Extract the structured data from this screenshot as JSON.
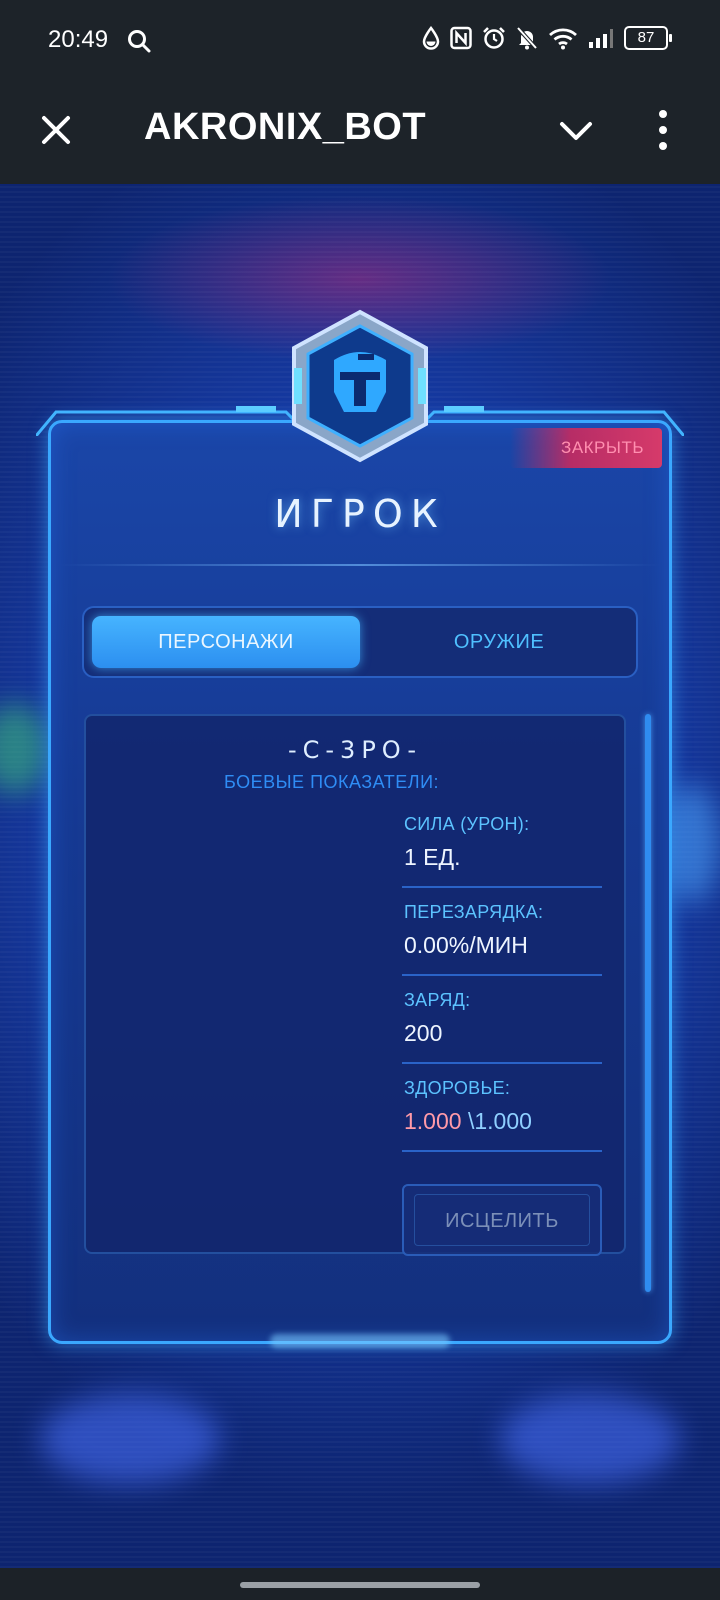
{
  "status_bar": {
    "time": "20:49",
    "battery": "87",
    "icons": [
      "search-icon",
      "drop-icon",
      "nfc-icon",
      "alarm-icon",
      "mute-icon",
      "wifi-icon",
      "signal-icon",
      "battery-icon"
    ]
  },
  "app_bar": {
    "title": "AKRONIX_BOT",
    "icons": [
      "close-icon",
      "chevron-down-icon",
      "more-vertical-icon"
    ]
  },
  "panel": {
    "close_label": "ЗАКРЫТЬ",
    "title": "ИГРОК",
    "emblem_icon": "helmet-icon"
  },
  "tabs": [
    {
      "label": "ПЕРСОНАЖИ",
      "active": true
    },
    {
      "label": "ОРУЖИЕ",
      "active": false
    }
  ],
  "character": {
    "name": "-C-3PO-",
    "stats_heading": "БОЕВЫЕ ПОКАЗАТЕЛИ:",
    "stats": {
      "power_label": "СИЛА (УРОН):",
      "power_value": "1 ЕД.",
      "reload_label": "ПЕРЕЗАРЯДКА:",
      "reload_value": "0.00%/МИН",
      "charge_label": "ЗАРЯД:",
      "charge_value": "200",
      "health_label": "ЗДОРОВЬЕ:",
      "health_current": "1.000",
      "health_max": "\\1.000"
    },
    "heal_button": "ИСЦЕЛИТЬ"
  },
  "colors": {
    "accent": "#3aa8ff",
    "tab_active": "#2c8ff0",
    "close_tag": "#d63a6a",
    "health_current": "#ff9aa8"
  }
}
